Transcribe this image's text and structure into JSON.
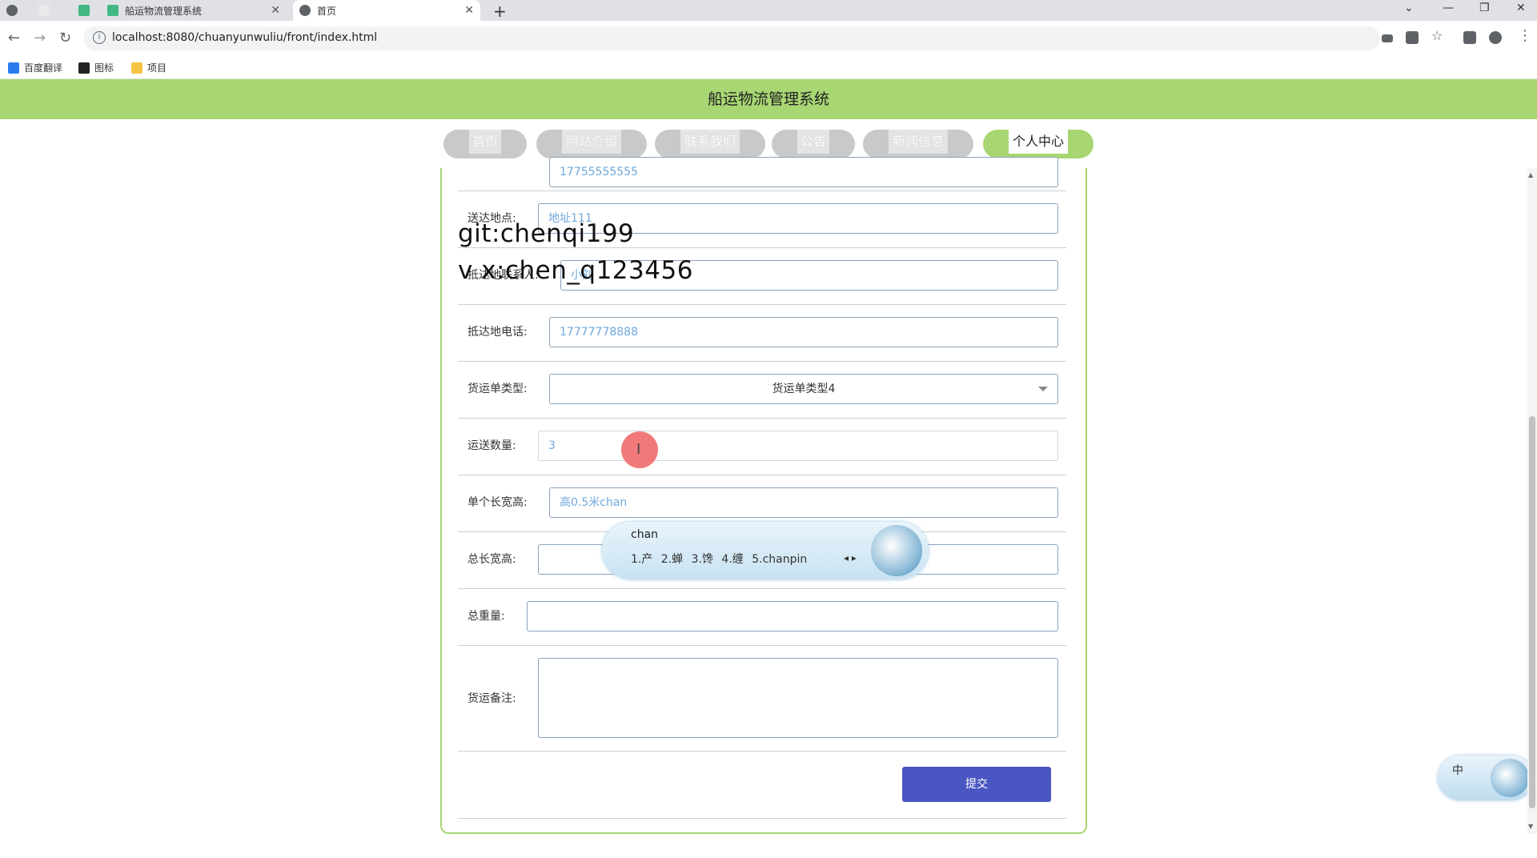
{
  "browser": {
    "tabs": [
      {
        "title": ""
      },
      {
        "title": ""
      },
      {
        "title": "船运物流管理系统"
      },
      {
        "title": "首页"
      }
    ],
    "url": "localhost:8080/chuanyunwuliu/front/index.html",
    "bookmarks": [
      "百度翻译",
      "图标",
      "项目"
    ]
  },
  "header": {
    "title": "船运物流管理系统"
  },
  "nav": {
    "items": [
      "首页",
      "网站介绍",
      "联系我们",
      "公告",
      "新闻信息",
      "个人中心"
    ],
    "active": "个人中心"
  },
  "form": {
    "fields": [
      {
        "label": "",
        "value": "17755555555"
      },
      {
        "label": "送达地点:",
        "value": "地址111"
      },
      {
        "label": "抵达地联系人:",
        "value": "小刘"
      },
      {
        "label": "抵达地电话:",
        "value": "17777778888"
      },
      {
        "label": "货运单类型:",
        "value": "货运单类型4"
      },
      {
        "label": "运送数量:",
        "value": "3"
      },
      {
        "label": "单个长宽高:",
        "value": "高0.5米chan"
      },
      {
        "label": "总长宽高:",
        "value": ""
      },
      {
        "label": "总重量:",
        "value": ""
      },
      {
        "label": "货运备注:",
        "value": ""
      }
    ],
    "submit_label": "提交"
  },
  "watermark": {
    "line1": "git:chenqi199",
    "line2": "v x:chen_q123456"
  },
  "ime": {
    "composition": "chan",
    "candidates": "1.产  2.蝉  3.馋  4.缠  5.chanpin",
    "status": "中"
  }
}
